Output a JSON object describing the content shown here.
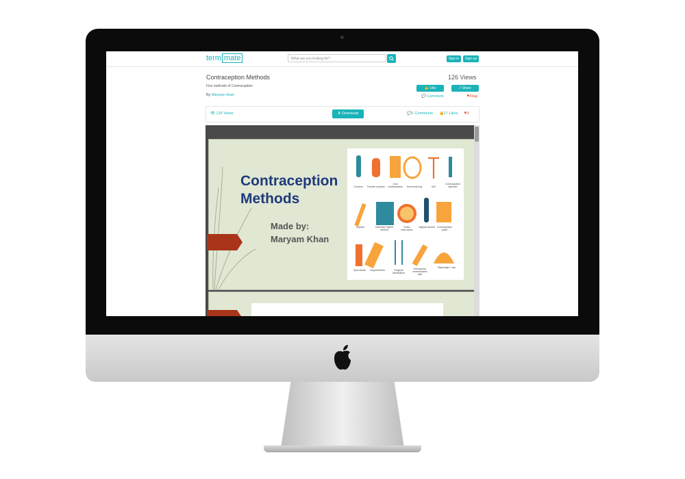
{
  "site": {
    "logo_left": "term",
    "logo_right": "mate",
    "search_placeholder": "What are you looking for?",
    "signin_label": "Sign in",
    "signup_label": "Sign up"
  },
  "doc": {
    "title": "Contraception Methods",
    "subtitle": "Five methods of Contraception",
    "by_prefix": "By",
    "author": "Maryam khan",
    "views_header": "126 Views",
    "like_label": "Like",
    "share_label": "Share",
    "comment_label": "Comment",
    "flag_label": "Flag"
  },
  "stats": {
    "views": "126 Views",
    "download_label": "Download",
    "comments": "1 Comments",
    "likes": "17 Likes",
    "flags": "0"
  },
  "slide": {
    "title_line1": "Contraception",
    "title_line2": "Methods",
    "made_by": "Made by:",
    "author": "Maryam Khan",
    "labels": [
      "Condom",
      "Female condom",
      "Oral contraception",
      "Hormonal ring",
      "IUD",
      "Contraceptive injection",
      "Implant",
      "Calendar rhythm method",
      "Coitus interruptus",
      "Vaginal douche",
      "Contraceptive patch",
      "Spermicide",
      "Suppositories",
      "Surgical sterilization",
      "Emergency contraception pills",
      "Diaphragm / cap"
    ]
  },
  "colors": {
    "accent": "#19b3b8",
    "slide_bg": "#e0e7d2",
    "slide_title": "#1f3a7a",
    "arrow": "#a8351a",
    "flag": "#e04a1f"
  }
}
